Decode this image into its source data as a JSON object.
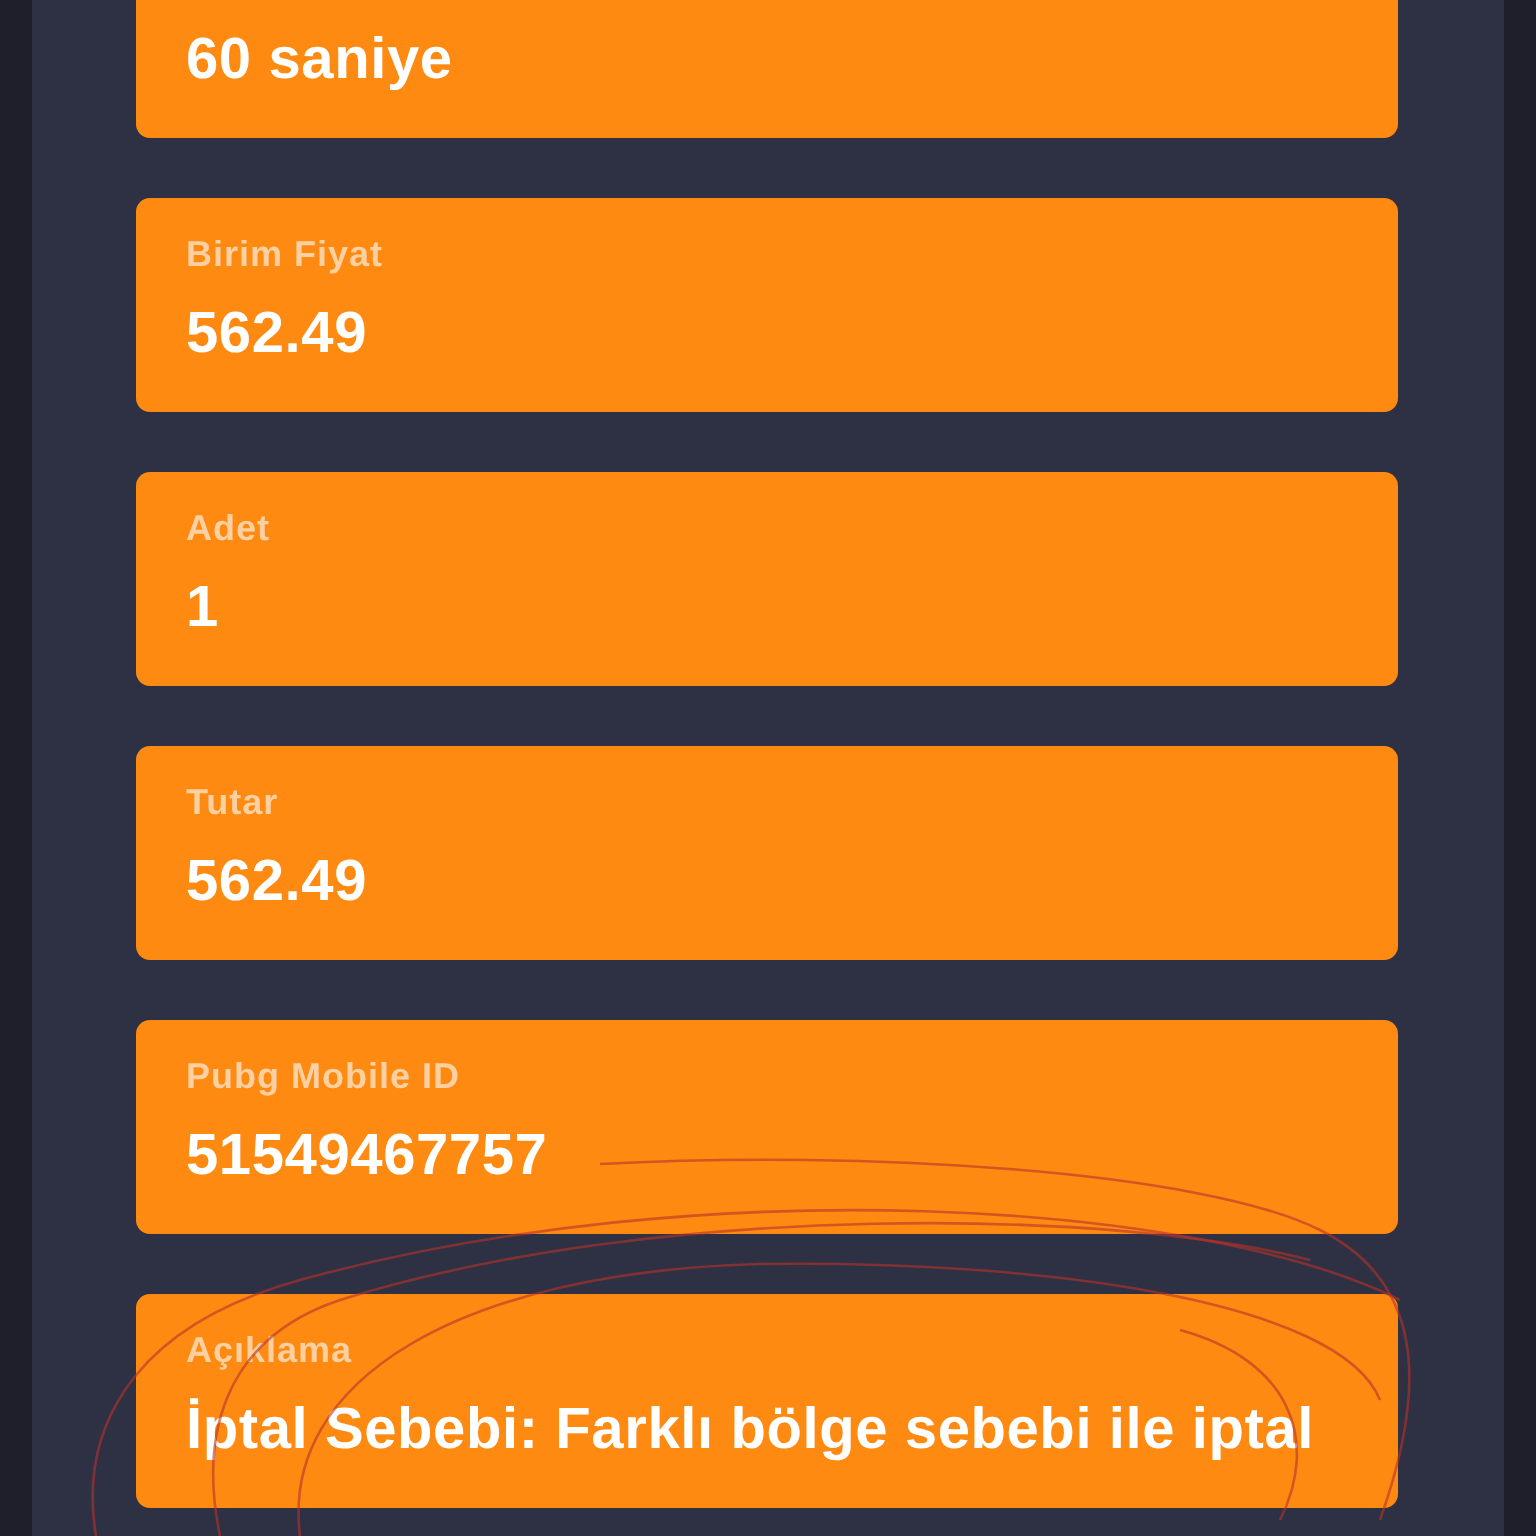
{
  "fields": [
    {
      "value": "60 saniye"
    },
    {
      "label": "Birim Fiyat",
      "value": "562.49"
    },
    {
      "label": "Adet",
      "value": "1"
    },
    {
      "label": "Tutar",
      "value": "562.49"
    },
    {
      "label": "Pubg Mobile ID",
      "value": "51549467757"
    },
    {
      "label": "Açıklama",
      "value": "İptal Sebebi: Farklı bölge sebebi ile iptal"
    }
  ]
}
